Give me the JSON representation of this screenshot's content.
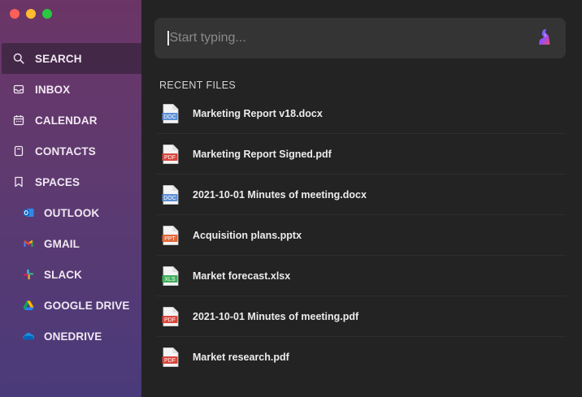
{
  "sidebar": {
    "items": [
      {
        "label": "SEARCH",
        "icon": "search-icon",
        "active": true
      },
      {
        "label": "INBOX",
        "icon": "inbox-icon"
      },
      {
        "label": "CALENDAR",
        "icon": "calendar-icon"
      },
      {
        "label": "CONTACTS",
        "icon": "contacts-icon"
      },
      {
        "label": "SPACES",
        "icon": "bookmark-icon"
      },
      {
        "label": "OUTLOOK",
        "icon": "outlook-icon"
      },
      {
        "label": "GMAIL",
        "icon": "gmail-icon"
      },
      {
        "label": "SLACK",
        "icon": "slack-icon"
      },
      {
        "label": "GOOGLE DRIVE",
        "icon": "google-drive-icon"
      },
      {
        "label": "ONEDRIVE",
        "icon": "onedrive-icon"
      }
    ]
  },
  "search": {
    "placeholder": "Start typing...",
    "value": ""
  },
  "recent": {
    "title": "RECENT FILES",
    "files": [
      {
        "name": "Marketing Report v18.docx",
        "type": "DOC",
        "color": "#5b8fd6"
      },
      {
        "name": "Marketing Report Signed.pdf",
        "type": "PDF",
        "color": "#d9453b"
      },
      {
        "name": "2021-10-01 Minutes of meeting.docx",
        "type": "DOC",
        "color": "#5b8fd6"
      },
      {
        "name": "Acquisition plans.pptx",
        "type": "PPT",
        "color": "#e0673a"
      },
      {
        "name": "Market forecast.xlsx",
        "type": "XLS",
        "color": "#3fae5a"
      },
      {
        "name": "2021-10-01 Minutes of meeting.pdf",
        "type": "PDF",
        "color": "#d9453b"
      },
      {
        "name": "Market research.pdf",
        "type": "PDF",
        "color": "#d9453b"
      }
    ]
  },
  "colors": {
    "sidebar_top": "#6b3566",
    "sidebar_bottom": "#4a3a7a",
    "main_bg": "#232323",
    "search_bg": "#343434"
  }
}
